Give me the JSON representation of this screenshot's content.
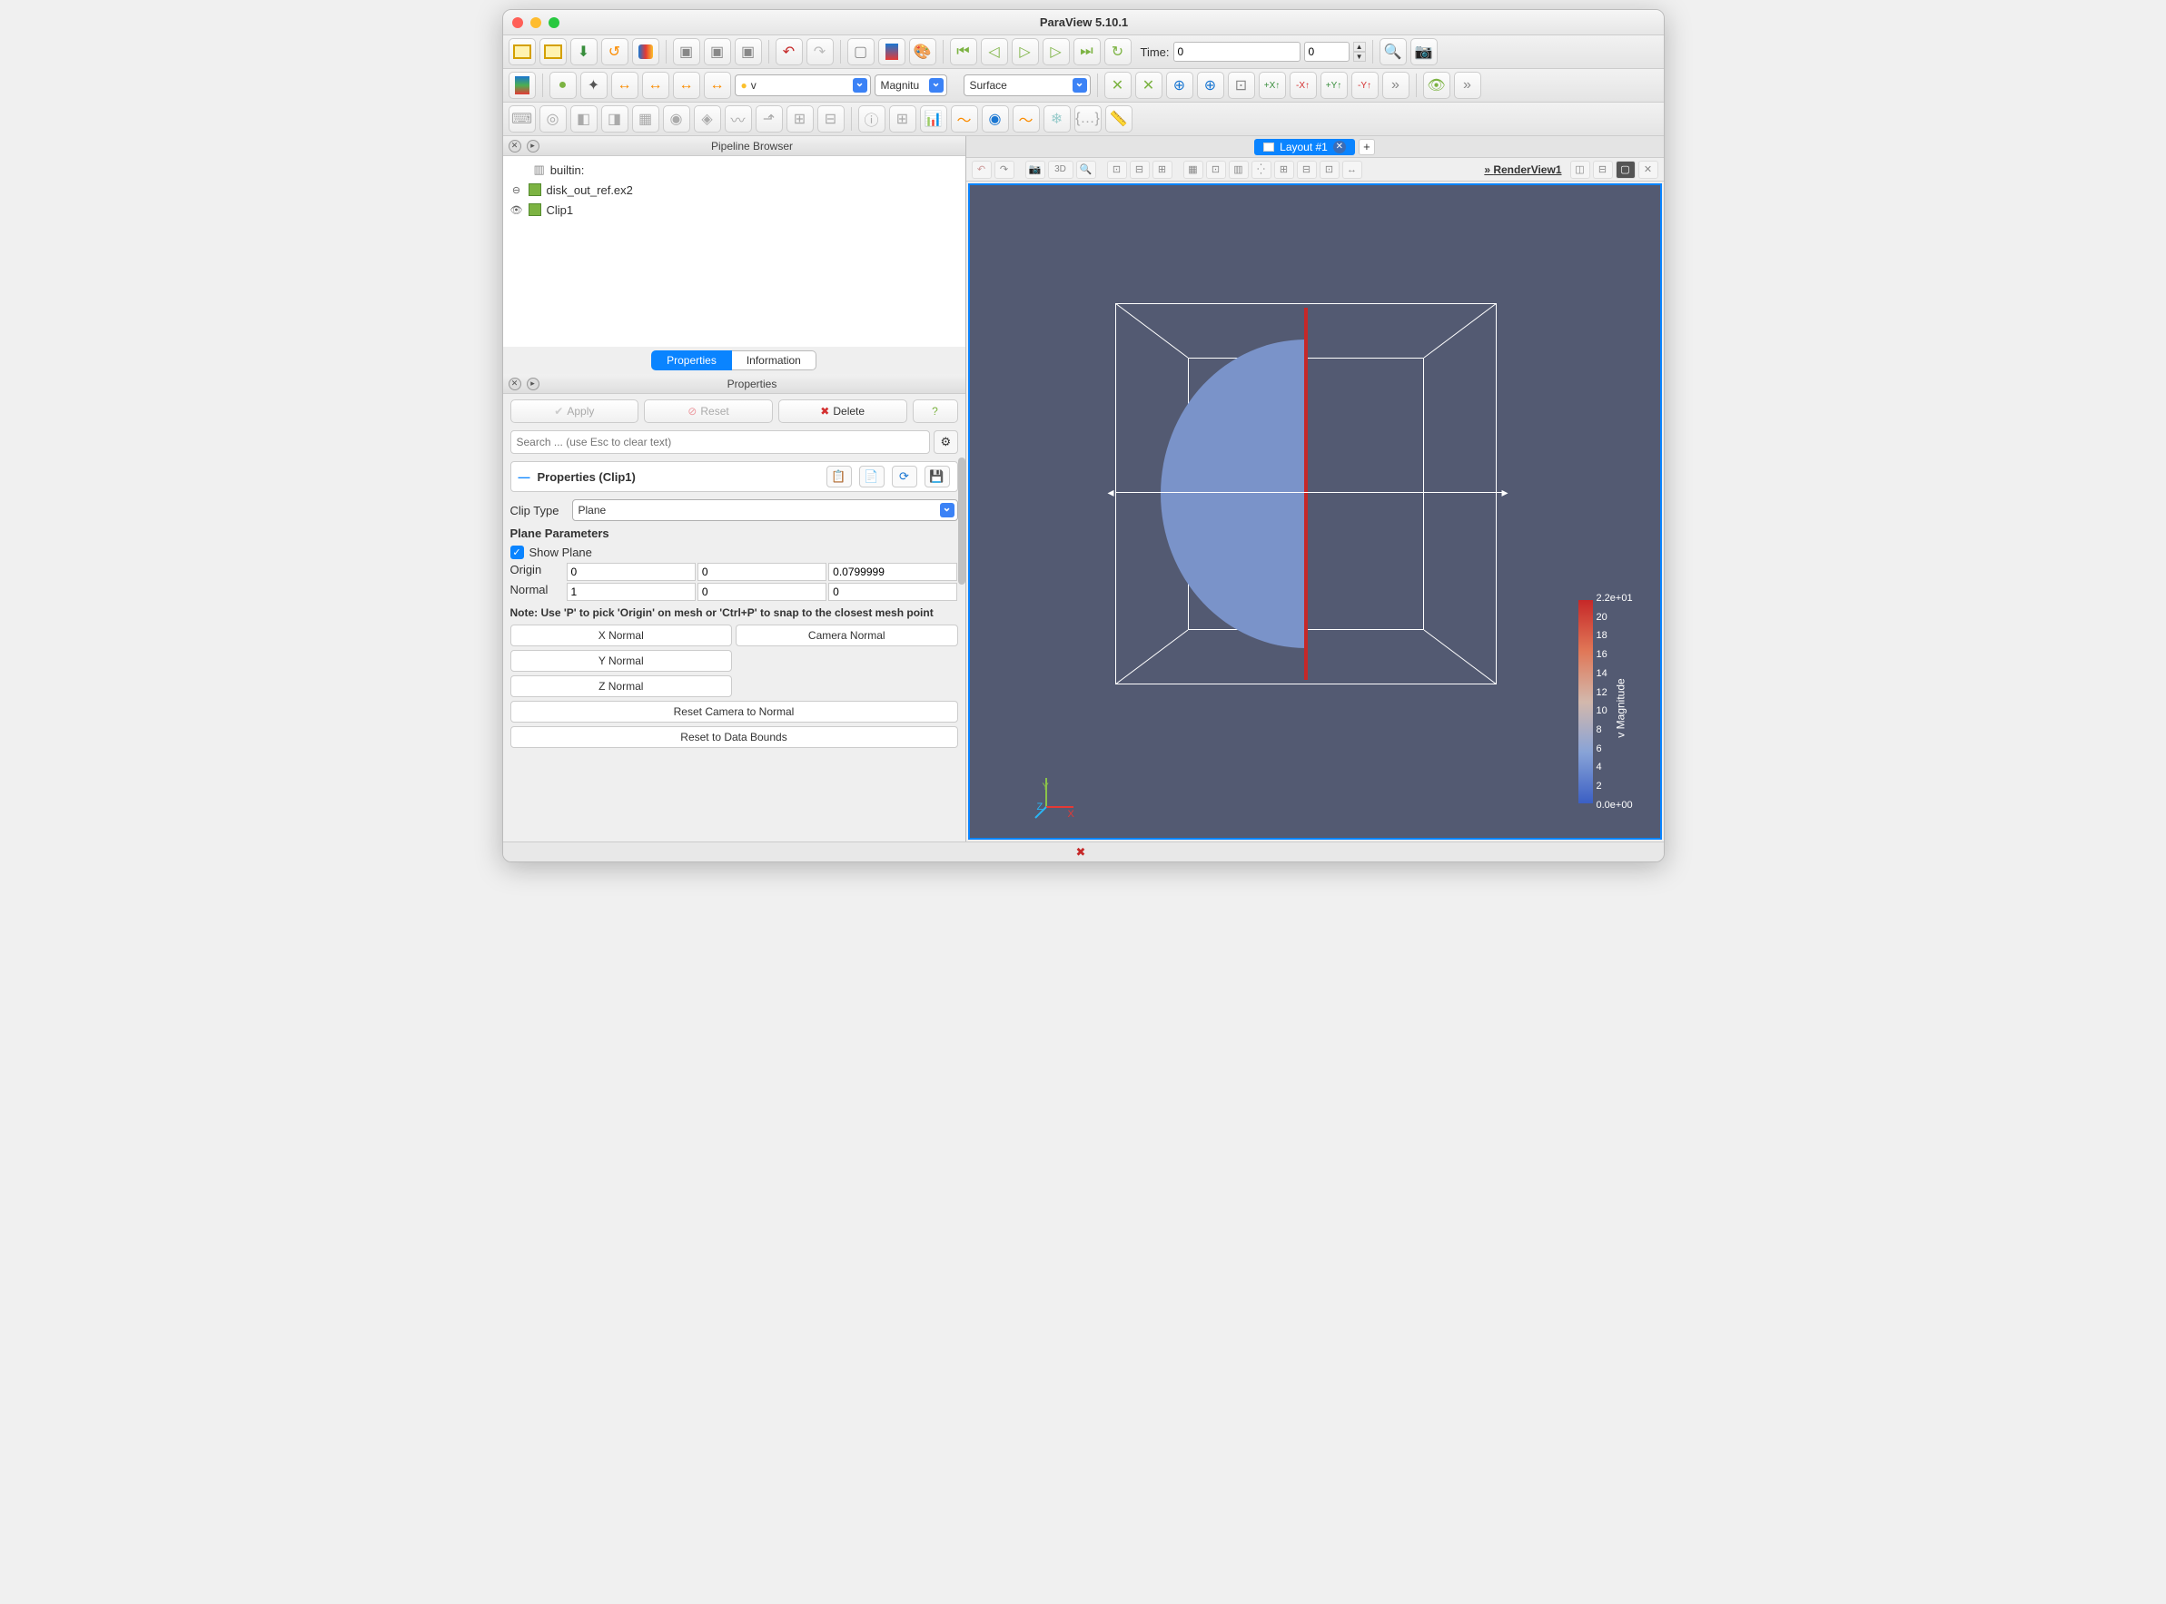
{
  "title": "ParaView 5.10.1",
  "time": {
    "label": "Time:",
    "value": "0",
    "index": "0"
  },
  "toolbar2": {
    "field": "v",
    "component": "Magnitu",
    "representation": "Surface"
  },
  "pipeline": {
    "title": "Pipeline Browser",
    "root": "builtin:",
    "items": [
      "disk_out_ref.ex2",
      "Clip1"
    ]
  },
  "tabs": {
    "properties": "Properties",
    "information": "Information"
  },
  "properties_panel_title": "Properties",
  "buttons": {
    "apply": "Apply",
    "reset": "Reset",
    "delete": "Delete"
  },
  "search_placeholder": "Search ... (use Esc to clear text)",
  "section_title": "Properties (Clip1)",
  "clip": {
    "type_label": "Clip Type",
    "type_value": "Plane",
    "params_title": "Plane Parameters",
    "show_plane": "Show Plane",
    "origin_label": "Origin",
    "origin": [
      "0",
      "0",
      "0.0799999"
    ],
    "normal_label": "Normal",
    "normal": [
      "1",
      "0",
      "0"
    ],
    "note": "Note: Use 'P' to pick 'Origin' on mesh or 'Ctrl+P' to snap to the closest mesh point",
    "btns": {
      "xn": "X Normal",
      "yn": "Y Normal",
      "zn": "Z Normal",
      "cam": "Camera Normal",
      "reset_cam": "Reset Camera to Normal",
      "reset_bounds": "Reset to Data Bounds"
    }
  },
  "layout": {
    "tab": "Layout #1",
    "view": "RenderView1"
  },
  "axes": {
    "x": "X",
    "y": "Y",
    "z": "Z"
  },
  "colorbar": {
    "label": "v Magnitude",
    "ticks": [
      "2.2e+01",
      "20",
      "18",
      "16",
      "14",
      "12",
      "10",
      "8",
      "6",
      "4",
      "2",
      "0.0e+00"
    ]
  },
  "view_mode": "3D"
}
